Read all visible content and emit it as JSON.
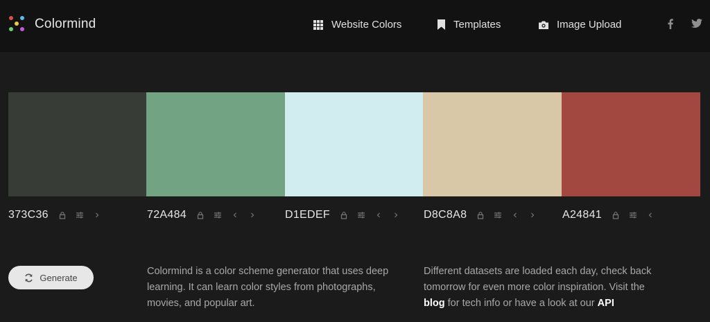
{
  "header": {
    "brand": "Colormind",
    "nav": [
      {
        "label": "Website Colors",
        "icon": "grid-icon"
      },
      {
        "label": "Templates",
        "icon": "bookmark-icon"
      },
      {
        "label": "Image Upload",
        "icon": "camera-icon"
      }
    ],
    "social": [
      "facebook-icon",
      "twitter-icon"
    ]
  },
  "palette": [
    {
      "hex": "373C36",
      "color": "#373C36"
    },
    {
      "hex": "72A484",
      "color": "#72A484"
    },
    {
      "hex": "D1EDEF",
      "color": "#D1EDEF"
    },
    {
      "hex": "D8C8A8",
      "color": "#D8C8A8"
    },
    {
      "hex": "A24841",
      "color": "#A24841"
    }
  ],
  "generate": {
    "label": "Generate"
  },
  "about": "Colormind is a color scheme generator that uses deep learning. It can learn color styles from photographs, movies, and popular art.",
  "datasets": {
    "text1": "Different datasets are loaded each day, check back tomorrow for even more color inspiration. Visit the",
    "blog": "blog",
    "text2": "for tech info or have a look at our",
    "api": "API"
  }
}
